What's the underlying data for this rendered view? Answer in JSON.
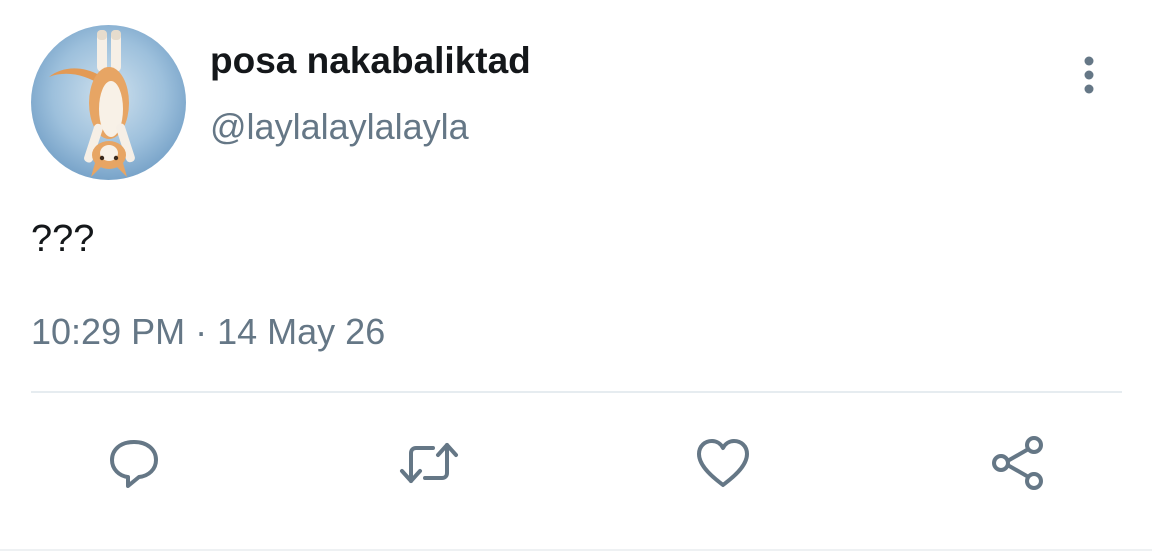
{
  "author": {
    "display_name": "posa nakabaliktad",
    "handle": "@laylalaylalayla",
    "avatar_icon": "upside-down-cat-avatar"
  },
  "tweet": {
    "text": "???",
    "time": "10:29 PM",
    "separator": "·",
    "date": "14 May 26"
  },
  "actions": {
    "reply_icon": "reply-icon",
    "retweet_icon": "retweet-icon",
    "like_icon": "heart-icon",
    "share_icon": "share-icon",
    "more_icon": "more-vertical-icon"
  },
  "colors": {
    "name_text": "#14171a",
    "secondary_text": "#657786",
    "icon_stroke": "#657786",
    "divider": "#e6ecf0",
    "avatar_bg": "#8fb6d6"
  }
}
